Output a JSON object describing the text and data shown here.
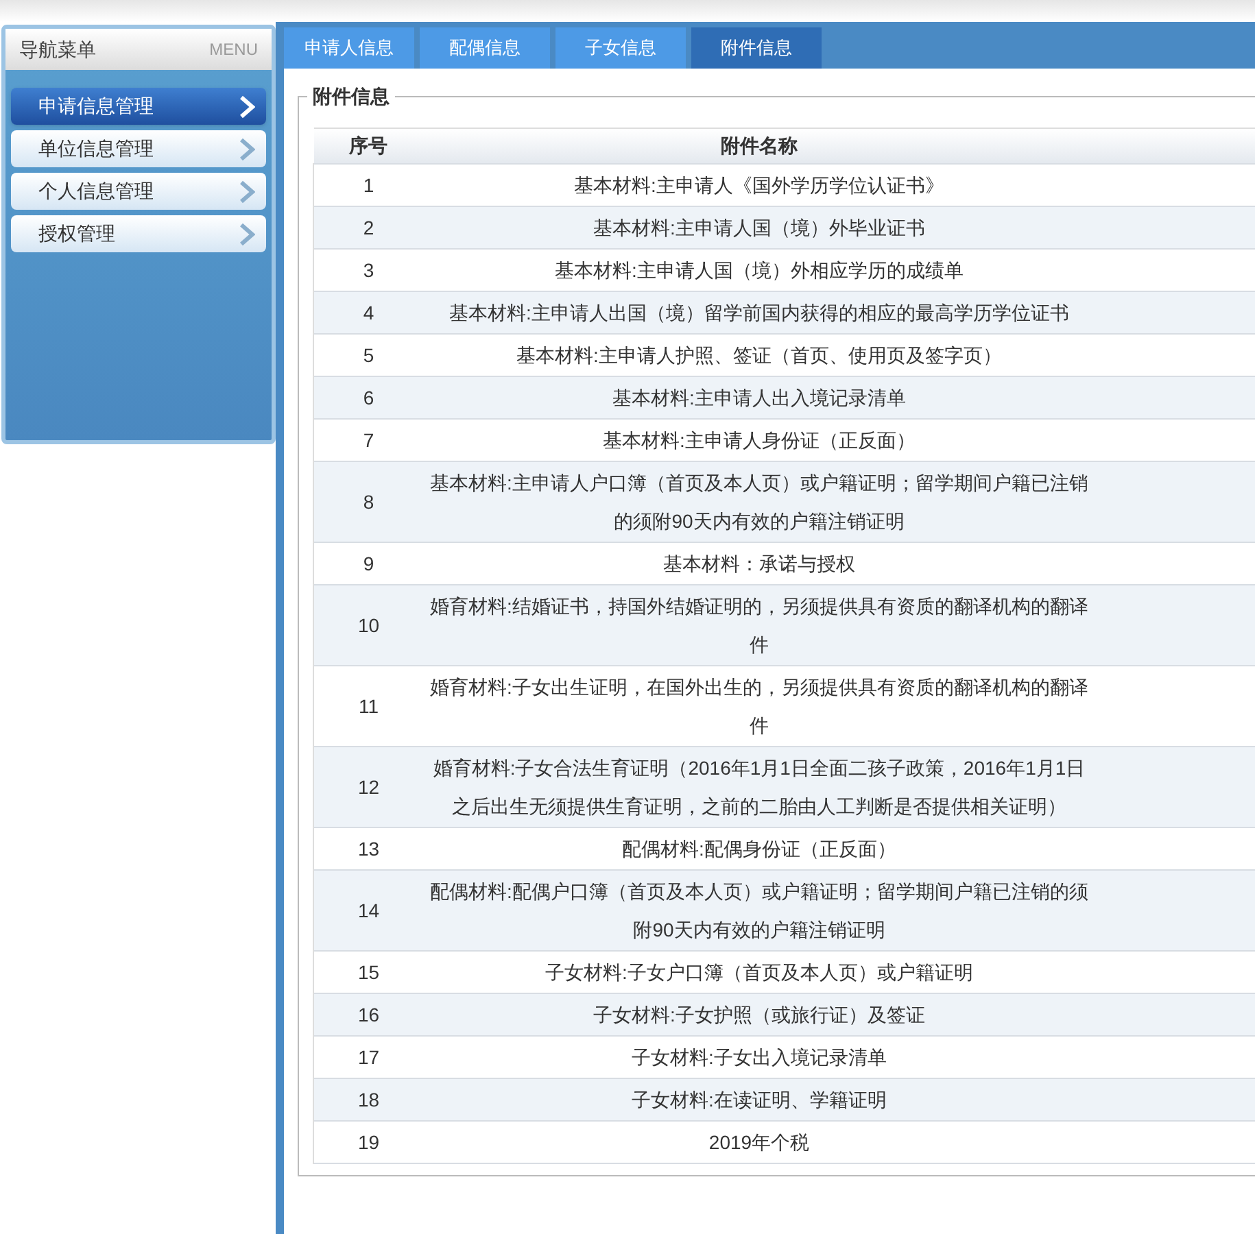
{
  "sidebar": {
    "title": "导航菜单",
    "title_en": "MENU",
    "items": [
      {
        "label": "申请信息管理",
        "selected": true
      },
      {
        "label": "单位信息管理",
        "selected": false
      },
      {
        "label": "个人信息管理",
        "selected": false
      },
      {
        "label": "授权管理",
        "selected": false
      }
    ]
  },
  "tabs": [
    {
      "label": "申请人信息",
      "selected": false
    },
    {
      "label": "配偶信息",
      "selected": false
    },
    {
      "label": "子女信息",
      "selected": false
    },
    {
      "label": "附件信息",
      "selected": true
    }
  ],
  "section": {
    "legend": "附件信息"
  },
  "table": {
    "columns": [
      "序号",
      "附件名称"
    ],
    "rows": [
      [
        "1",
        "基本材料:主申请人《国外学历学位认证书》"
      ],
      [
        "2",
        "基本材料:主申请人国（境）外毕业证书"
      ],
      [
        "3",
        "基本材料:主申请人国（境）外相应学历的成绩单"
      ],
      [
        "4",
        "基本材料:主申请人出国（境）留学前国内获得的相应的最高学历学位证书"
      ],
      [
        "5",
        "基本材料:主申请人护照、签证（首页、使用页及签字页）"
      ],
      [
        "6",
        "基本材料:主申请人出入境记录清单"
      ],
      [
        "7",
        "基本材料:主申请人身份证（正反面）"
      ],
      [
        "8",
        "基本材料:主申请人户口簿（首页及本人页）或户籍证明；留学期间户籍已注销的须附90天内有效的户籍注销证明"
      ],
      [
        "9",
        "基本材料：承诺与授权"
      ],
      [
        "10",
        "婚育材料:结婚证书，持国外结婚证明的，另须提供具有资质的翻译机构的翻译件"
      ],
      [
        "11",
        "婚育材料:子女出生证明，在国外出生的，另须提供具有资质的翻译机构的翻译件"
      ],
      [
        "12",
        "婚育材料:子女合法生育证明（2016年1月1日全面二孩子政策，2016年1月1日之后出生无须提供生育证明，之前的二胎由人工判断是否提供相关证明）"
      ],
      [
        "13",
        "配偶材料:配偶身份证（正反面）"
      ],
      [
        "14",
        "配偶材料:配偶户口簿（首页及本人页）或户籍证明；留学期间户籍已注销的须附90天内有效的户籍注销证明"
      ],
      [
        "15",
        "子女材料:子女户口簿（首页及本人页）或户籍证明"
      ],
      [
        "16",
        "子女材料:子女护照（或旅行证）及签证"
      ],
      [
        "17",
        "子女材料:子女出入境记录清单"
      ],
      [
        "18",
        "子女材料:在读证明、学籍证明"
      ],
      [
        "19",
        "2019年个税"
      ]
    ]
  }
}
